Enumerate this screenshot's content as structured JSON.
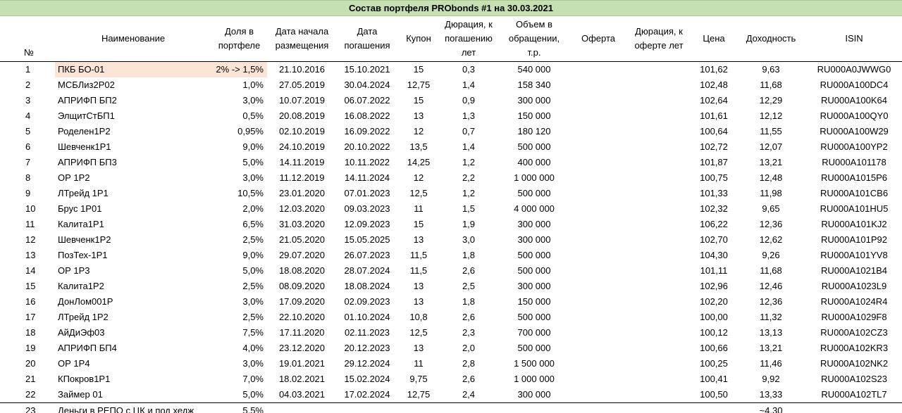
{
  "title": "Состав портфеля PRObonds #1 на 30.03.2021",
  "headers": {
    "num": "№",
    "name": "Наименование",
    "share": "Доля в\nпортфеле",
    "placement": "Дата начала\nразмещения",
    "maturity": "Дата\nпогашения",
    "coupon": "Купон",
    "duration": "Дюрация, к\nпогашению\nлет",
    "volume": "Объем в\nобращении,\nт.р.",
    "offer": "Оферта",
    "duration_offer": "Дюрация, к\nоферте лет",
    "price": "Цена",
    "yield": "Доходность",
    "isin": "ISIN"
  },
  "rows": [
    {
      "num": "1",
      "name": "ПКБ БО-01",
      "share": "2% -> 1,5%",
      "placement": "21.10.2016",
      "maturity": "15.10.2021",
      "coupon": "15",
      "duration": "0,3",
      "volume": "540 000",
      "offer": "",
      "duration_offer": "",
      "price": "101,62",
      "yield": "9,63",
      "isin": "RU000A0JWWG0"
    },
    {
      "num": "2",
      "name": "МСБЛиз2Р02",
      "share": "1,0%",
      "placement": "27.05.2019",
      "maturity": "30.04.2024",
      "coupon": "12,75",
      "duration": "1,4",
      "volume": "158 340",
      "offer": "",
      "duration_offer": "",
      "price": "102,48",
      "yield": "11,68",
      "isin": "RU000A100DC4"
    },
    {
      "num": "3",
      "name": "АПРИФП БП2",
      "share": "3,0%",
      "placement": "10.07.2019",
      "maturity": "06.07.2022",
      "coupon": "15",
      "duration": "0,9",
      "volume": "300 000",
      "offer": "",
      "duration_offer": "",
      "price": "102,64",
      "yield": "12,29",
      "isin": "RU000A100K64"
    },
    {
      "num": "4",
      "name": "ЭлщитСтБП1",
      "share": "0,5%",
      "placement": "20.08.2019",
      "maturity": "16.08.2022",
      "coupon": "13",
      "duration": "1,3",
      "volume": "150 000",
      "offer": "",
      "duration_offer": "",
      "price": "101,61",
      "yield": "12,12",
      "isin": "RU000A100QY0"
    },
    {
      "num": "5",
      "name": "Роделен1Р2",
      "share": "0,95%",
      "placement": "02.10.2019",
      "maturity": "16.09.2022",
      "coupon": "12",
      "duration": "0,7",
      "volume": "180 120",
      "offer": "",
      "duration_offer": "",
      "price": "100,64",
      "yield": "11,55",
      "isin": "RU000A100W29"
    },
    {
      "num": "6",
      "name": "Шевченк1Р1",
      "share": "9,0%",
      "placement": "24.10.2019",
      "maturity": "20.10.2022",
      "coupon": "13,5",
      "duration": "1,4",
      "volume": "500 000",
      "offer": "",
      "duration_offer": "",
      "price": "102,72",
      "yield": "12,07",
      "isin": "RU000A100YP2"
    },
    {
      "num": "7",
      "name": "АПРИФП БП3",
      "share": "5,0%",
      "placement": "14.11.2019",
      "maturity": "10.11.2022",
      "coupon": "14,25",
      "duration": "1,2",
      "volume": "400 000",
      "offer": "",
      "duration_offer": "",
      "price": "101,87",
      "yield": "13,21",
      "isin": "RU000A101178"
    },
    {
      "num": "8",
      "name": "ОР 1Р2",
      "share": "3,0%",
      "placement": "11.12.2019",
      "maturity": "14.11.2024",
      "coupon": "12",
      "duration": "2,2",
      "volume": "1 000 000",
      "offer": "",
      "duration_offer": "",
      "price": "100,75",
      "yield": "12,48",
      "isin": "RU000A1015P6"
    },
    {
      "num": "9",
      "name": "ЛТрейд 1Р1",
      "share": "10,5%",
      "placement": "23.01.2020",
      "maturity": "07.01.2023",
      "coupon": "12,5",
      "duration": "1,2",
      "volume": "500 000",
      "offer": "",
      "duration_offer": "",
      "price": "101,33",
      "yield": "11,98",
      "isin": "RU000A101CB6"
    },
    {
      "num": "10",
      "name": "Брус 1Р01",
      "share": "2,0%",
      "placement": "12.03.2020",
      "maturity": "09.03.2023",
      "coupon": "11",
      "duration": "1,5",
      "volume": "4 000 000",
      "offer": "",
      "duration_offer": "",
      "price": "102,32",
      "yield": "9,65",
      "isin": "RU000A101HU5"
    },
    {
      "num": "11",
      "name": "Калита1Р1",
      "share": "6,5%",
      "placement": "31.03.2020",
      "maturity": "12.09.2023",
      "coupon": "15",
      "duration": "1,9",
      "volume": "300 000",
      "offer": "",
      "duration_offer": "",
      "price": "106,22",
      "yield": "12,36",
      "isin": "RU000A101KJ2"
    },
    {
      "num": "12",
      "name": "Шевченк1Р2",
      "share": "2,5%",
      "placement": "21.05.2020",
      "maturity": "15.05.2025",
      "coupon": "13",
      "duration": "3,0",
      "volume": "300 000",
      "offer": "",
      "duration_offer": "",
      "price": "102,70",
      "yield": "12,62",
      "isin": "RU000A101P92"
    },
    {
      "num": "13",
      "name": "ПозТех-1Р1",
      "share": "9,0%",
      "placement": "29.07.2020",
      "maturity": "26.07.2023",
      "coupon": "11,5",
      "duration": "1,8",
      "volume": "500 000",
      "offer": "",
      "duration_offer": "",
      "price": "104,30",
      "yield": "9,26",
      "isin": "RU000A101YV8"
    },
    {
      "num": "14",
      "name": "ОР 1Р3",
      "share": "5,0%",
      "placement": "18.08.2020",
      "maturity": "28.07.2024",
      "coupon": "11,5",
      "duration": "2,6",
      "volume": "500 000",
      "offer": "",
      "duration_offer": "",
      "price": "101,11",
      "yield": "11,68",
      "isin": "RU000A1021B4"
    },
    {
      "num": "15",
      "name": "Калита1Р2",
      "share": "2,5%",
      "placement": "08.09.2020",
      "maturity": "18.08.2024",
      "coupon": "13",
      "duration": "2,5",
      "volume": "300 000",
      "offer": "",
      "duration_offer": "",
      "price": "102,96",
      "yield": "12,46",
      "isin": "RU000A1023L9"
    },
    {
      "num": "16",
      "name": "ДонЛом001Р",
      "share": "3,0%",
      "placement": "17.09.2020",
      "maturity": "02.09.2023",
      "coupon": "13",
      "duration": "1,8",
      "volume": "150 000",
      "offer": "",
      "duration_offer": "",
      "price": "102,20",
      "yield": "12,36",
      "isin": "RU000A1024R4"
    },
    {
      "num": "17",
      "name": "ЛТрейд 1Р2",
      "share": "2,5%",
      "placement": "22.10.2020",
      "maturity": "01.10.2024",
      "coupon": "10,8",
      "duration": "2,6",
      "volume": "500 000",
      "offer": "",
      "duration_offer": "",
      "price": "100,00",
      "yield": "11,32",
      "isin": "RU000A1029F8"
    },
    {
      "num": "18",
      "name": "АйДиЭф03",
      "share": "7,5%",
      "placement": "17.11.2020",
      "maturity": "02.11.2023",
      "coupon": "12,5",
      "duration": "2,3",
      "volume": "700 000",
      "offer": "",
      "duration_offer": "",
      "price": "100,12",
      "yield": "13,13",
      "isin": "RU000A102CZ3"
    },
    {
      "num": "19",
      "name": "АПРИФП БП4",
      "share": "4,0%",
      "placement": "23.12.2020",
      "maturity": "20.12.2023",
      "coupon": "13",
      "duration": "2,0",
      "volume": "500 000",
      "offer": "",
      "duration_offer": "",
      "price": "100,66",
      "yield": "13,21",
      "isin": "RU000A102KR3"
    },
    {
      "num": "20",
      "name": "ОР 1Р4",
      "share": "3,0%",
      "placement": "19.01.2021",
      "maturity": "29.12.2024",
      "coupon": "11",
      "duration": "2,8",
      "volume": "1 500 000",
      "offer": "",
      "duration_offer": "",
      "price": "100,25",
      "yield": "11,46",
      "isin": "RU000A102NK2"
    },
    {
      "num": "21",
      "name": "КПокров1Р1",
      "share": "7,0%",
      "placement": "18.02.2021",
      "maturity": "15.02.2024",
      "coupon": "9,75",
      "duration": "2,6",
      "volume": "1 000 000",
      "offer": "",
      "duration_offer": "",
      "price": "100,41",
      "yield": "9,92",
      "isin": "RU000A102S23"
    },
    {
      "num": "22",
      "name": "Займер 01",
      "share": "5,0%",
      "placement": "04.03.2021",
      "maturity": "17.02.2024",
      "coupon": "12,75",
      "duration": "2,4",
      "volume": "300 000",
      "offer": "",
      "duration_offer": "",
      "price": "100,50",
      "yield": "13,33",
      "isin": "RU000A102TL7"
    },
    {
      "num": "23",
      "name": "Деньги в РЕПО с ЦК и под хедж",
      "share": "5,5%",
      "placement": "",
      "maturity": "",
      "coupon": "",
      "duration": "",
      "volume": "",
      "offer": "",
      "duration_offer": "",
      "price": "",
      "yield": "~4,30",
      "isin": ""
    }
  ],
  "highlight": {
    "row": 0,
    "color": "#fce4d6"
  },
  "colors": {
    "title_bg": "#c6e0b4"
  }
}
